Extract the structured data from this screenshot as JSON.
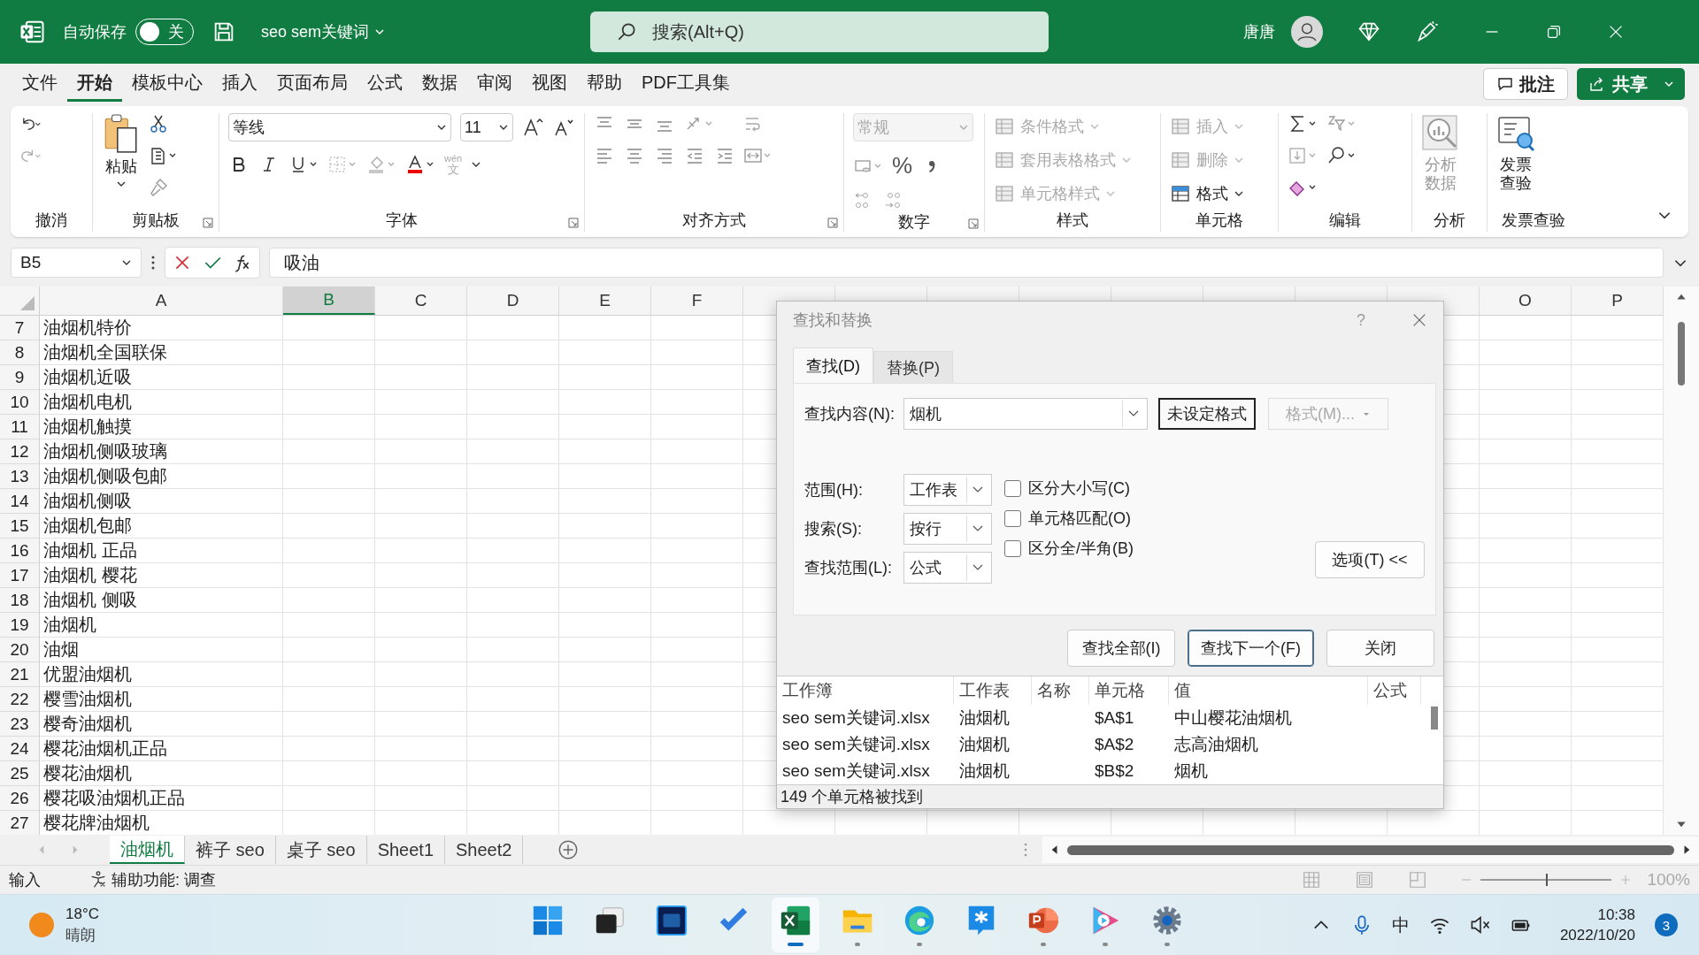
{
  "titlebar": {
    "autosave_label": "自动保存",
    "autosave": {
      "on": false,
      "label": "关"
    },
    "filename": "seo sem关键词",
    "search": {
      "placeholder": "搜索(Alt+Q)"
    },
    "user": "唐唐"
  },
  "menu": [
    {
      "label": "文件",
      "selected": false
    },
    {
      "label": "开始",
      "selected": true
    },
    {
      "label": "模板中心",
      "selected": false
    },
    {
      "label": "插入",
      "selected": false
    },
    {
      "label": "页面布局",
      "selected": false
    },
    {
      "label": "公式",
      "selected": false
    },
    {
      "label": "数据",
      "selected": false
    },
    {
      "label": "审阅",
      "selected": false
    },
    {
      "label": "视图",
      "selected": false
    },
    {
      "label": "帮助",
      "selected": false
    },
    {
      "label": "PDF工具集",
      "selected": false
    }
  ],
  "actions": {
    "comments": "批注",
    "share": "共享"
  },
  "ribbon": {
    "groups": [
      {
        "kind": "undo",
        "label": "撤消"
      },
      {
        "kind": "clipboard",
        "label": "剪贴板",
        "paste": "粘贴"
      },
      {
        "kind": "font",
        "label": "字体",
        "font": "等线",
        "size": "11",
        "phonetic": "wén",
        "phonetic_char": "文"
      },
      {
        "kind": "align",
        "label": "对齐方式"
      },
      {
        "kind": "number",
        "label": "数字",
        "format": "常规",
        "percent": "%"
      },
      {
        "kind": "styles",
        "label": "样式",
        "items": [
          {
            "label": "条件格式",
            "disabled": true
          },
          {
            "label": "套用表格格式",
            "disabled": true
          },
          {
            "label": "单元格样式",
            "disabled": true
          }
        ]
      },
      {
        "kind": "cells",
        "label": "单元格",
        "items": [
          {
            "label": "插入",
            "disabled": true
          },
          {
            "label": "删除",
            "disabled": true
          },
          {
            "label": "格式",
            "disabled": false
          }
        ]
      },
      {
        "kind": "editing",
        "label": "编辑"
      },
      {
        "kind": "analyze",
        "label": "分析",
        "button": "分析数据",
        "disabled": true
      },
      {
        "kind": "invoice",
        "label": "发票查验",
        "button": "发票查验",
        "disabled": false
      }
    ]
  },
  "formula_bar": {
    "name_box": "B5",
    "formula": "吸油"
  },
  "columns": [
    {
      "label": "A",
      "selected": false
    },
    {
      "label": "B",
      "selected": true
    },
    {
      "label": "C",
      "selected": false
    },
    {
      "label": "D",
      "selected": false
    },
    {
      "label": "E",
      "selected": false
    },
    {
      "label": "F",
      "selected": false
    },
    {
      "label": "O",
      "selected": false
    },
    {
      "label": "P",
      "selected": false
    }
  ],
  "rows": [
    {
      "number": "7",
      "a": "油烟机特价"
    },
    {
      "number": "8",
      "a": "油烟机全国联保"
    },
    {
      "number": "9",
      "a": "油烟机近吸"
    },
    {
      "number": "10",
      "a": "油烟机电机"
    },
    {
      "number": "11",
      "a": "油烟机触摸"
    },
    {
      "number": "12",
      "a": "油烟机侧吸玻璃"
    },
    {
      "number": "13",
      "a": "油烟机侧吸包邮"
    },
    {
      "number": "14",
      "a": "油烟机侧吸"
    },
    {
      "number": "15",
      "a": "油烟机包邮"
    },
    {
      "number": "16",
      "a": "油烟机 正品"
    },
    {
      "number": "17",
      "a": "油烟机 樱花"
    },
    {
      "number": "18",
      "a": "油烟机 侧吸"
    },
    {
      "number": "19",
      "a": "油烟机"
    },
    {
      "number": "20",
      "a": "油烟"
    },
    {
      "number": "21",
      "a": "优盟油烟机"
    },
    {
      "number": "22",
      "a": "樱雪油烟机"
    },
    {
      "number": "23",
      "a": "樱奇油烟机"
    },
    {
      "number": "24",
      "a": "樱花油烟机正品"
    },
    {
      "number": "25",
      "a": "樱花油烟机"
    },
    {
      "number": "26",
      "a": "樱花吸油烟机正品"
    },
    {
      "number": "27",
      "a": "樱花牌油烟机"
    }
  ],
  "sheet_tabs": [
    {
      "label": "油烟机",
      "selected": true
    },
    {
      "label": "裤子 seo",
      "selected": false
    },
    {
      "label": "桌子 seo",
      "selected": false
    },
    {
      "label": "Sheet1",
      "selected": false
    },
    {
      "label": "Sheet2",
      "selected": false
    }
  ],
  "status_bar": {
    "mode": "输入",
    "accessibility": "辅助功能: 调查",
    "zoom": {
      "label": "100%",
      "level": 0.5
    }
  },
  "dialog": {
    "title": "查找和替换",
    "help": "?",
    "tabs": [
      {
        "label": "查找(D)",
        "selected": true
      },
      {
        "label": "替换(P)",
        "selected": false
      }
    ],
    "find": {
      "label": "查找内容(N):",
      "value": "烟机"
    },
    "format_preview": "未设定格式",
    "format_button": {
      "label": "格式(M)...",
      "disabled": true
    },
    "options": [
      {
        "label": "范围(H):",
        "value": "工作表"
      },
      {
        "label": "搜索(S):",
        "value": "按行"
      },
      {
        "label": "查找范围(L):",
        "value": "公式"
      }
    ],
    "checks": [
      {
        "label": "区分大小写(C)",
        "checked": false
      },
      {
        "label": "单元格匹配(O)",
        "checked": false
      },
      {
        "label": "区分全/半角(B)",
        "checked": false
      }
    ],
    "options_button": "选项(T) <<",
    "buttons": [
      {
        "label": "查找全部(I)",
        "selected": false
      },
      {
        "label": "查找下一个(F)",
        "selected": true
      },
      {
        "label": "关闭",
        "selected": false
      }
    ],
    "result_columns": [
      "工作簿",
      "工作表",
      "名称",
      "单元格",
      "值",
      "公式"
    ],
    "results": [
      {
        "workbook": "seo sem关键词.xlsx",
        "sheet": "油烟机",
        "cell": "$A$1",
        "value": "中山樱花油烟机"
      },
      {
        "workbook": "seo sem关键词.xlsx",
        "sheet": "油烟机",
        "cell": "$A$2",
        "value": "志高油烟机"
      },
      {
        "workbook": "seo sem关键词.xlsx",
        "sheet": "油烟机",
        "cell": "$B$2",
        "value": "烟机"
      }
    ],
    "status": "149 个单元格被找到"
  },
  "taskbar": {
    "weather": {
      "temp": "18°C",
      "desc": "晴朗"
    },
    "apps": [
      {
        "kind": "start",
        "running": false,
        "selected": false
      },
      {
        "kind": "taskview",
        "running": false,
        "selected": false
      },
      {
        "kind": "photo",
        "running": false,
        "selected": false
      },
      {
        "kind": "todo",
        "running": false,
        "selected": false
      },
      {
        "kind": "excel",
        "running": true,
        "selected": true
      },
      {
        "kind": "folder",
        "running": true,
        "selected": false
      },
      {
        "kind": "browser",
        "running": true,
        "selected": false
      },
      {
        "kind": "chat",
        "running": false,
        "selected": false
      },
      {
        "kind": "slides",
        "running": true,
        "selected": false
      },
      {
        "kind": "video",
        "running": true,
        "selected": false
      },
      {
        "kind": "settings",
        "running": true,
        "selected": false
      }
    ],
    "tray": {
      "ime": "中",
      "time": "10:38",
      "date": "2022/10/20",
      "notifications": "3"
    }
  }
}
